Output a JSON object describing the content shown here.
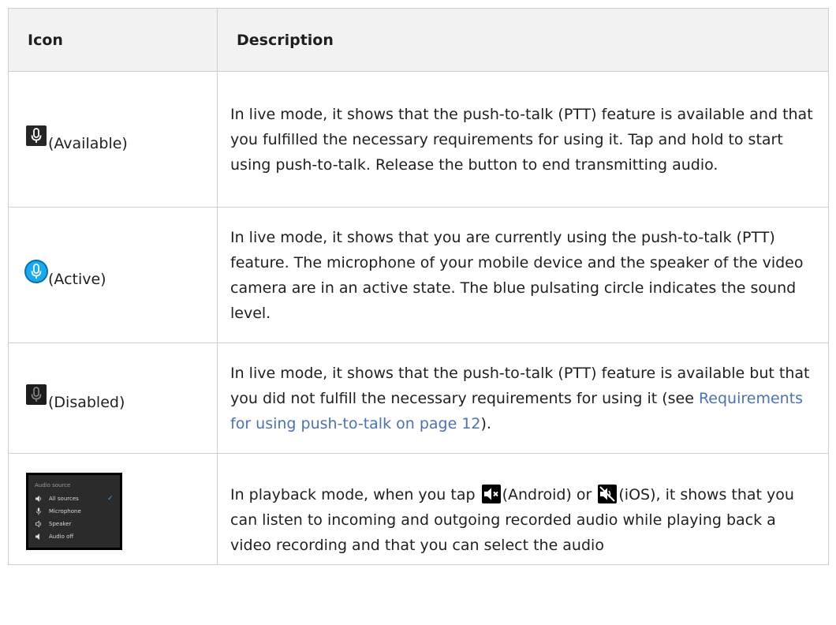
{
  "table": {
    "headers": {
      "icon": "Icon",
      "description": "Description"
    },
    "rows": [
      {
        "icon_name": "microphone-available-icon",
        "state_label": "(Available)",
        "description": "In live mode, it shows that the push-to-talk (PTT) feature is available and that you fulfilled the necessary requirements for using it. Tap and hold to start using push-to-talk. Release the button to end transmitting audio."
      },
      {
        "icon_name": "microphone-active-icon",
        "state_label": "(Active)",
        "description": "In live mode, it shows that you are currently using the push-to-talk (PTT) feature. The microphone of your mobile device and the speaker of the video camera are in an active state. The blue pulsating circle indicates the sound level."
      },
      {
        "icon_name": "microphone-disabled-icon",
        "state_label": "(Disabled)",
        "description_before": "In live mode, it shows that the push-to-talk (PTT) feature is available but that you did not fulfill the necessary requirements for using it (see ",
        "link_text": "Requirements for using push-to-talk on page 12",
        "description_after": ")."
      },
      {
        "icon_name": "audio-source-menu-icon",
        "audio_panel": {
          "title": "Audio source",
          "options": [
            {
              "label": "All sources",
              "icon": "speaker-icon",
              "selected": true
            },
            {
              "label": "Microphone",
              "icon": "microphone-icon",
              "selected": false
            },
            {
              "label": "Speaker",
              "icon": "speaker-outline-icon",
              "selected": false
            },
            {
              "label": "Audio off",
              "icon": "speaker-off-icon",
              "selected": false
            }
          ],
          "check_mark": "✓"
        },
        "description_part1": "In playback mode, when you tap ",
        "android_label": "(Android) or ",
        "ios_label": "(iOS), it shows that you can listen to incoming and outgoing recorded audio while playing back a video recording and that you can select the audio",
        "android_icon": "speaker-muted-android-icon",
        "ios_icon": "speaker-muted-ios-icon"
      }
    ]
  },
  "colors": {
    "link": "#4a72b8",
    "header_bg": "#f2f2f2",
    "border": "#cfcfcf",
    "active_blue": "#15aaf2"
  }
}
